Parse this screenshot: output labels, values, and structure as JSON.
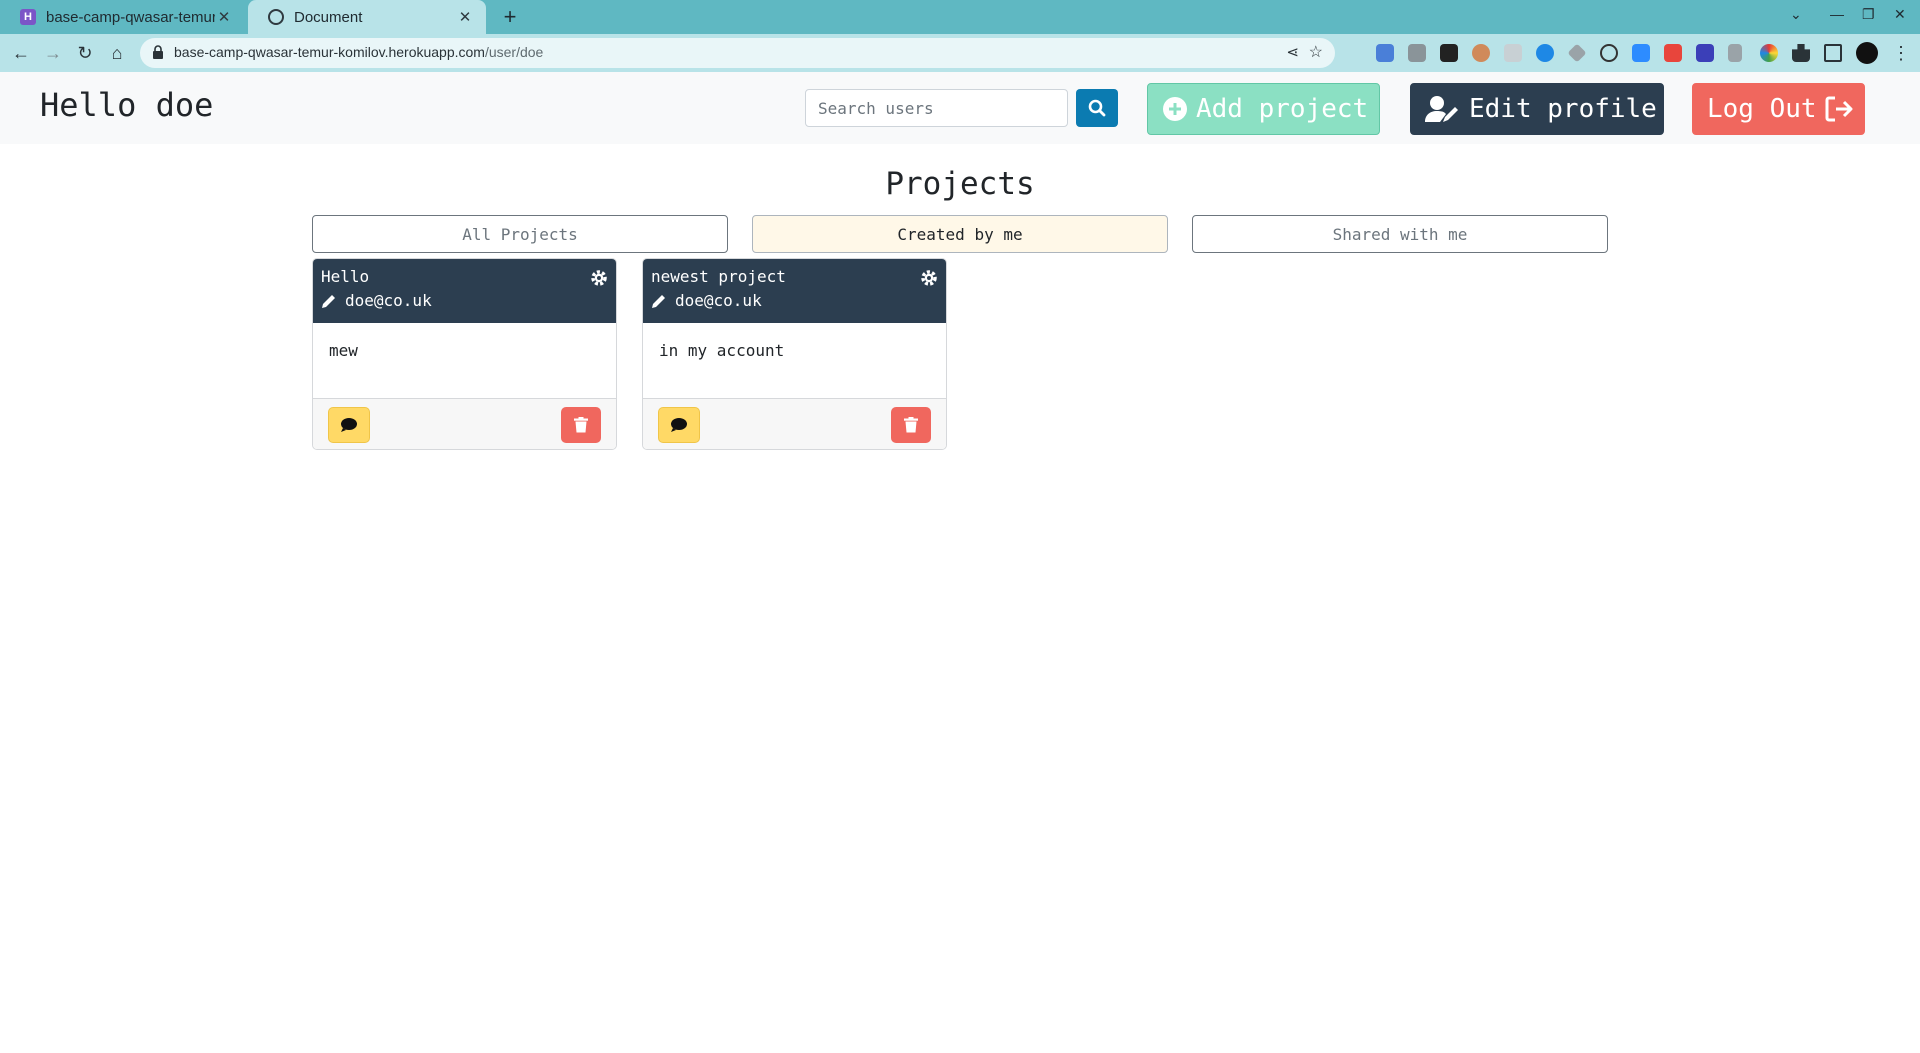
{
  "browser": {
    "tabs": [
      {
        "title": "base-camp-qwasar-temur-komilov.herokuapp.com",
        "favicon_letter": "H",
        "active": false
      },
      {
        "title": "Document",
        "active": true
      }
    ],
    "new_tab_label": "+",
    "url_host": "base-camp-qwasar-temur-komilov.herokuapp.com",
    "url_path": "/user/doe"
  },
  "header": {
    "greeting": "Hello doe",
    "search_placeholder": "Search users",
    "add_project_label": "Add project",
    "edit_profile_label": "Edit profile",
    "logout_label": "Log Out"
  },
  "main": {
    "title": "Projects",
    "filters": [
      {
        "label": "All Projects",
        "active": false
      },
      {
        "label": "Created by me",
        "active": true
      },
      {
        "label": "Shared with me",
        "active": false
      }
    ],
    "projects": [
      {
        "name": "Hello",
        "owner": "doe@co.uk",
        "description": "mew"
      },
      {
        "name": "newest project",
        "owner": "doe@co.uk",
        "description": "in my account"
      }
    ]
  },
  "colors": {
    "tabstrip": "#5fb8c2",
    "primary_dark": "#2c3e50",
    "success_light": "#8be0c3",
    "danger": "#f0675e",
    "info": "#0b7bb1",
    "warning": "#ffd966"
  },
  "icons": {
    "search": "search-icon",
    "add": "plus-circle-icon",
    "edit_profile": "user-edit-icon",
    "logout": "sign-out-icon",
    "gear": "gear-icon",
    "pencil": "pencil-icon",
    "comment": "comment-icon",
    "trash": "trash-icon"
  }
}
